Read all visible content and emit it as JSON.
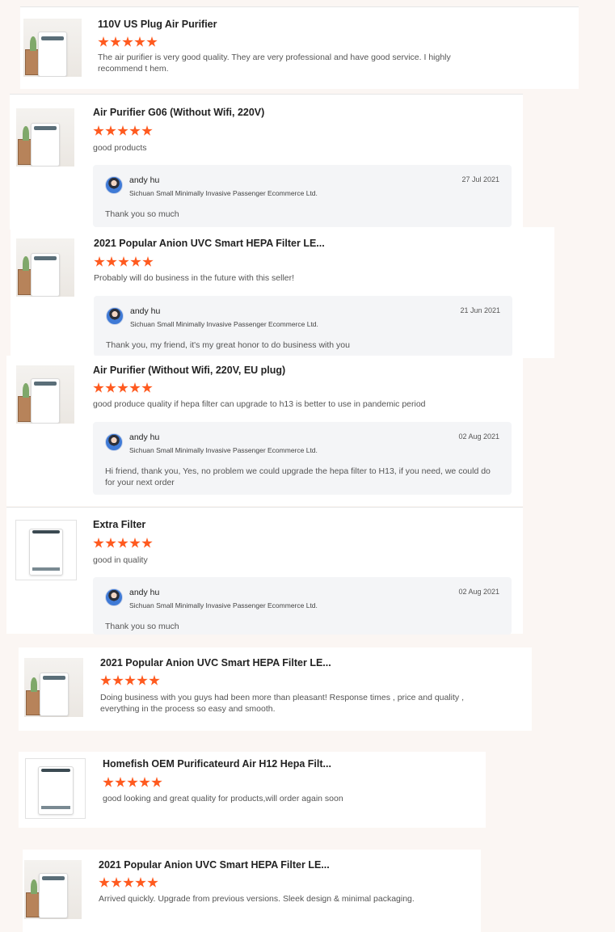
{
  "reviews": [
    {
      "product": "110V US Plug Air Purifier",
      "rating": 5,
      "text": "The air purifier is very good quality. They are very professional and have good service. I highly recommend t hem.",
      "thumbnail_icon": "air-purifier-room-photo"
    },
    {
      "product": "Air Purifier G06 (Without Wifi, 220V)",
      "rating": 5,
      "text": "good products",
      "thumbnail_icon": "air-purifier-room-photo",
      "reply": {
        "name": "andy hu",
        "company": "Sichuan Small Minimally Invasive Passenger Ecommerce Ltd.",
        "date": "27 Jul 2021",
        "message": "Thank you so much"
      }
    },
    {
      "product": "2021 Popular Anion UVC Smart HEPA Filter LE...",
      "rating": 5,
      "text": "Probably will do business in the future with this seller!",
      "thumbnail_icon": "air-purifier-room-photo",
      "reply": {
        "name": "andy hu",
        "company": "Sichuan Small Minimally Invasive Passenger Ecommerce Ltd.",
        "date": "21 Jun 2021",
        "message": "Thank you, my friend, it's my great honor to do business with you"
      }
    },
    {
      "product": "Air Purifier (Without Wifi, 220V, EU plug)",
      "rating": 5,
      "text": "good produce quality if hepa filter can upgrade to h13 is better to use in pandemic period",
      "thumbnail_icon": "air-purifier-room-photo",
      "reply": {
        "name": "andy hu",
        "company": "Sichuan Small Minimally Invasive Passenger Ecommerce Ltd.",
        "date": "02 Aug 2021",
        "message": "Hi friend, thank you, Yes, no problem we could upgrade the hepa filter to H13, if you need, we could do for your next order"
      }
    },
    {
      "product": "Extra Filter",
      "rating": 5,
      "text": "good in quality",
      "thumbnail_icon": "air-purifier-product-photo",
      "reply": {
        "name": "andy hu",
        "company": "Sichuan Small Minimally Invasive Passenger Ecommerce Ltd.",
        "date": "02 Aug 2021",
        "message": "Thank you so much"
      }
    },
    {
      "product": "2021 Popular Anion UVC Smart HEPA Filter LE...",
      "rating": 5,
      "text": "Doing business with you guys had been more than pleasant! Response times , price and quality , everything in the process so easy and smooth.",
      "thumbnail_icon": "air-purifier-room-photo"
    },
    {
      "product": "Homefish OEM Purificateurd Air H12 Hepa Filt...",
      "rating": 5,
      "text": "good looking and great quality for products,will order again soon",
      "thumbnail_icon": "air-purifier-product-photo"
    },
    {
      "product": "2021 Popular Anion UVC Smart HEPA Filter LE...",
      "rating": 5,
      "text": "Arrived quickly. Upgrade from previous versions. Sleek design & minimal packaging.",
      "thumbnail_icon": "air-purifier-room-photo"
    }
  ],
  "colors": {
    "star": "#ff5a1f",
    "reply_background": "#f4f5f7",
    "page_background": "#fbf6f3"
  }
}
